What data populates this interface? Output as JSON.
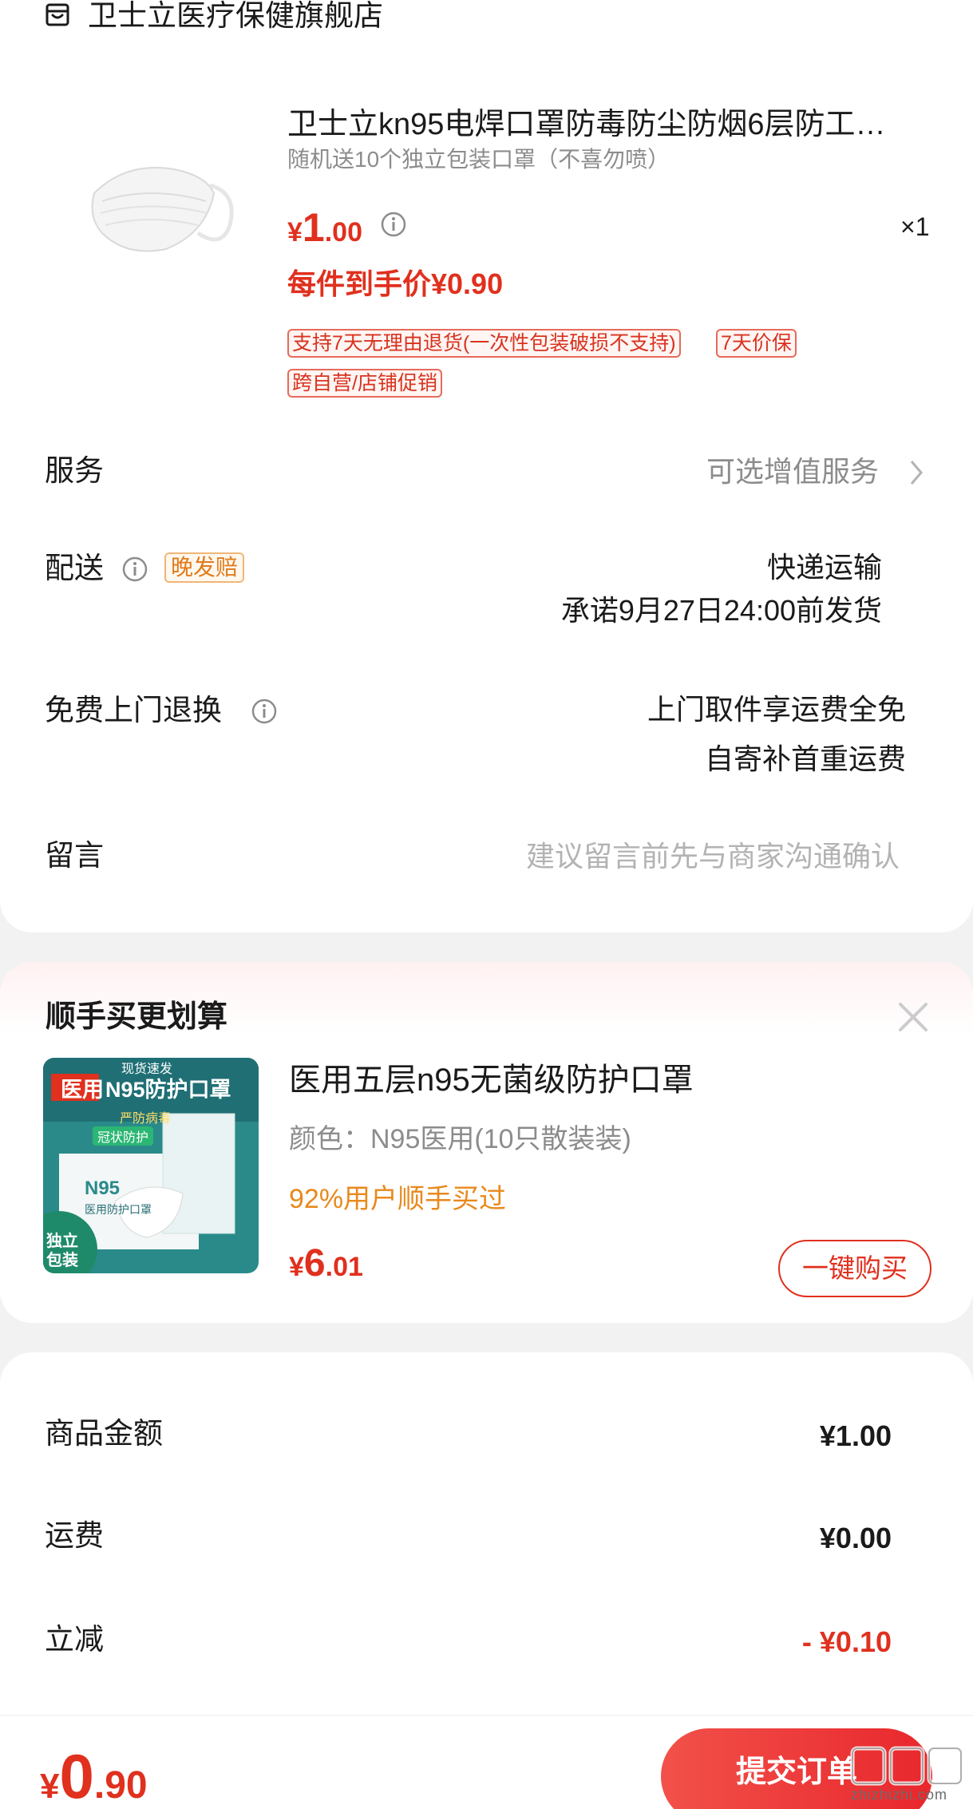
{
  "shop": {
    "icon": "store-icon",
    "name": "卫士立医疗保健旗舰店"
  },
  "product": {
    "image": "face-mask-image",
    "title": "卫士立kn95电焊口罩防毒防尘防烟6层防工…",
    "subtitle": "随机送10个独立包装口罩（不喜勿喷）",
    "price_currency": "¥",
    "price_int": "1",
    "price_dec": ".00",
    "quantity": "×1",
    "net_price": "每件到手价¥0.90",
    "tags": [
      "支持7天无理由退货(一次性包装破损不支持)",
      "7天价保",
      "跨自营/店铺促销"
    ]
  },
  "rows": {
    "service": {
      "label": "服务",
      "value": "可选增值服务"
    },
    "delivery": {
      "label": "配送",
      "badge": "晚发赔",
      "method": "快递运输",
      "promise": "承诺9月27日24:00前发货"
    },
    "return": {
      "label": "免费上门退换",
      "line1": "上门取件享运费全免",
      "line2": "自寄补首重运费"
    },
    "message": {
      "label": "留言",
      "placeholder": "建议留言前先与商家沟通确认"
    }
  },
  "addon": {
    "title": "顺手买更划算",
    "product_name": "医用五层n95无菌级防护口罩",
    "spec": "颜色：N95医用(10只散装装)",
    "social": "92%用户顺手买过",
    "price_currency": "¥",
    "price_int": "6",
    "price_dec": ".01",
    "buy_label": "一键购买",
    "image_text": {
      "top": "现货速发",
      "headline_a": "医用",
      "headline_b": "N95防护口罩",
      "sub1": "严防病毒",
      "sub2": "冠状防护",
      "box": "N95",
      "box_sub": "医用防护口罩",
      "corner": "独立包装"
    }
  },
  "summary": {
    "goods_label": "商品金额",
    "goods_value": "¥1.00",
    "shipping_label": "运费",
    "shipping_value": "¥0.00",
    "discount_label": "立减",
    "discount_value": "- ¥0.10"
  },
  "bottom": {
    "total_currency": "¥",
    "total_int": "0",
    "total_dec": ".90",
    "submit_label": "提交订单",
    "watermark": "zhizhizhi.com"
  },
  "colors": {
    "accent": "#e0301e",
    "orange": "#e8891c",
    "muted": "#8c8c8c"
  }
}
